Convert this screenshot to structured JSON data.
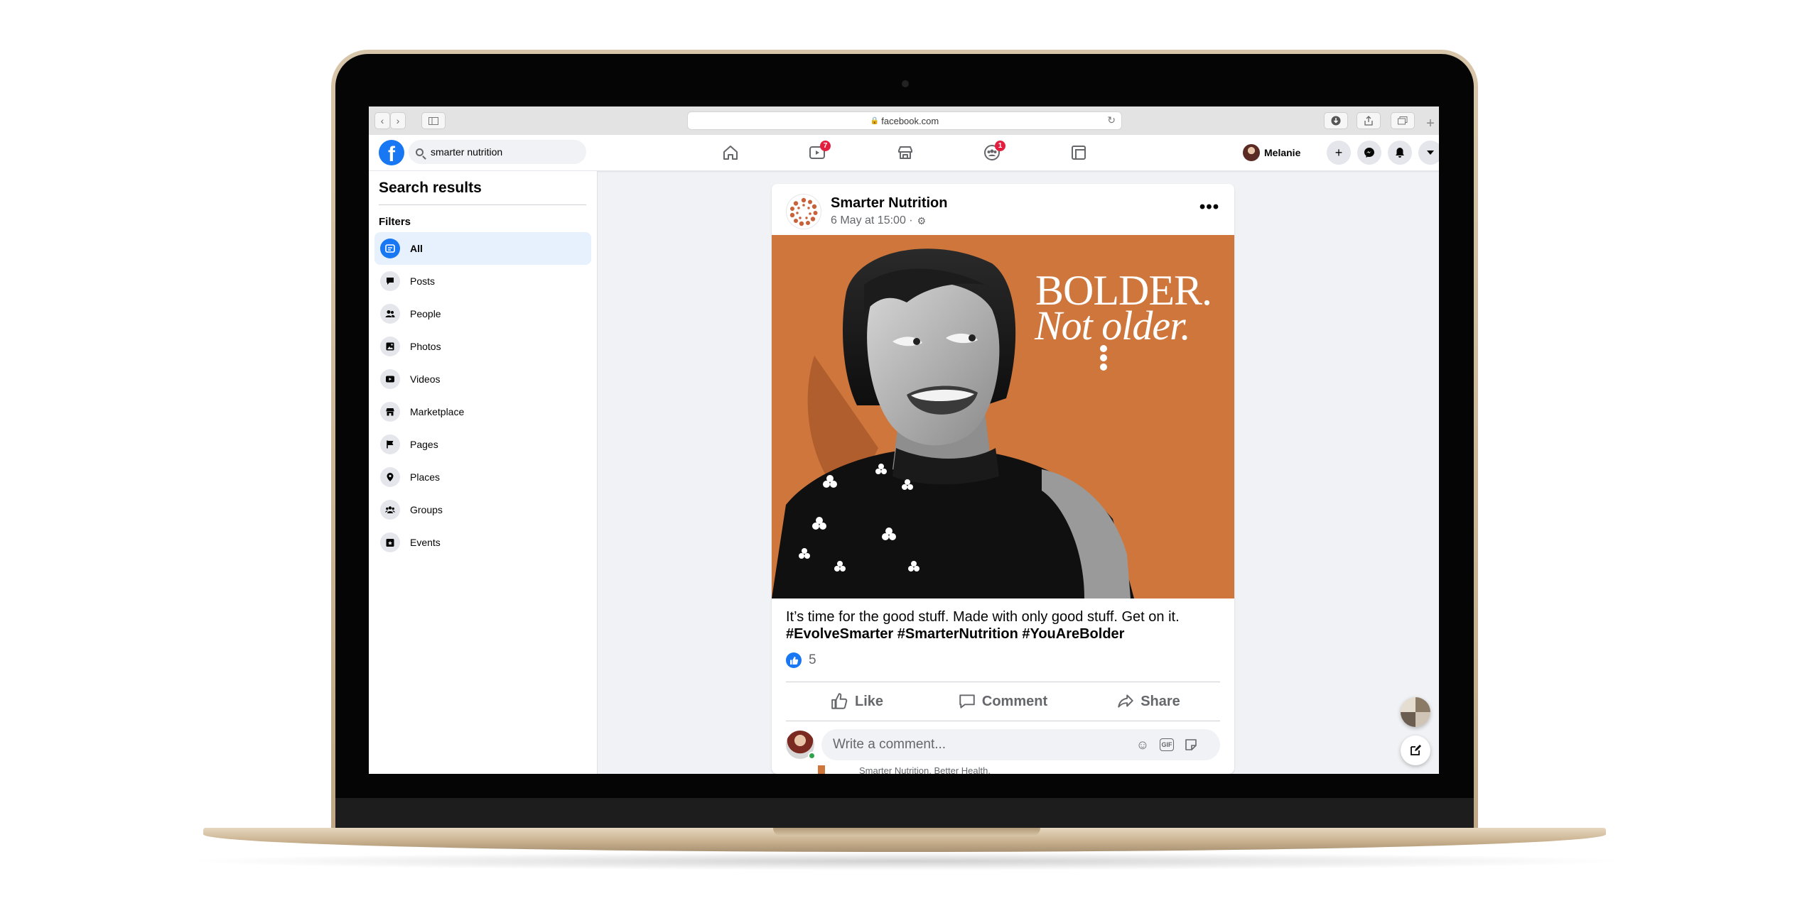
{
  "browser": {
    "url": "facebook.com"
  },
  "facebook": {
    "search_value": "smarter nutrition",
    "nav_badges": {
      "watch": "7",
      "groups": "1"
    },
    "profile_name": "Melanie"
  },
  "sidebar": {
    "title": "Search results",
    "filters_label": "Filters",
    "items": [
      {
        "label": "All",
        "icon": "all-results-icon",
        "active": true
      },
      {
        "label": "Posts",
        "icon": "posts-icon"
      },
      {
        "label": "People",
        "icon": "people-icon"
      },
      {
        "label": "Photos",
        "icon": "photos-icon"
      },
      {
        "label": "Videos",
        "icon": "videos-icon"
      },
      {
        "label": "Marketplace",
        "icon": "marketplace-icon"
      },
      {
        "label": "Pages",
        "icon": "flag-icon"
      },
      {
        "label": "Places",
        "icon": "location-pin-icon"
      },
      {
        "label": "Groups",
        "icon": "groups-icon"
      },
      {
        "label": "Events",
        "icon": "calendar-star-icon"
      }
    ]
  },
  "post": {
    "author": "Smarter Nutrition",
    "timestamp": "6 May at 15:00 ·",
    "image_headline_1": "BOLDER.",
    "image_headline_2": "Not older.",
    "text": "It’s time for the good stuff. Made with only good stuff. Get on it.",
    "hashtags": "#EvolveSmarter #SmarterNutrition #YouAreBolder",
    "reaction_count": "5",
    "actions": {
      "like": "Like",
      "comment": "Comment",
      "share": "Share"
    },
    "comment_placeholder": "Write a comment...",
    "next_post_peek": "Smarter Nutrition. Better Health."
  },
  "colors": {
    "facebook_blue": "#1877f2",
    "image_orange": "#cf763c",
    "badge_red": "#e41e3f",
    "laptop_gold": "#c9b18f"
  }
}
